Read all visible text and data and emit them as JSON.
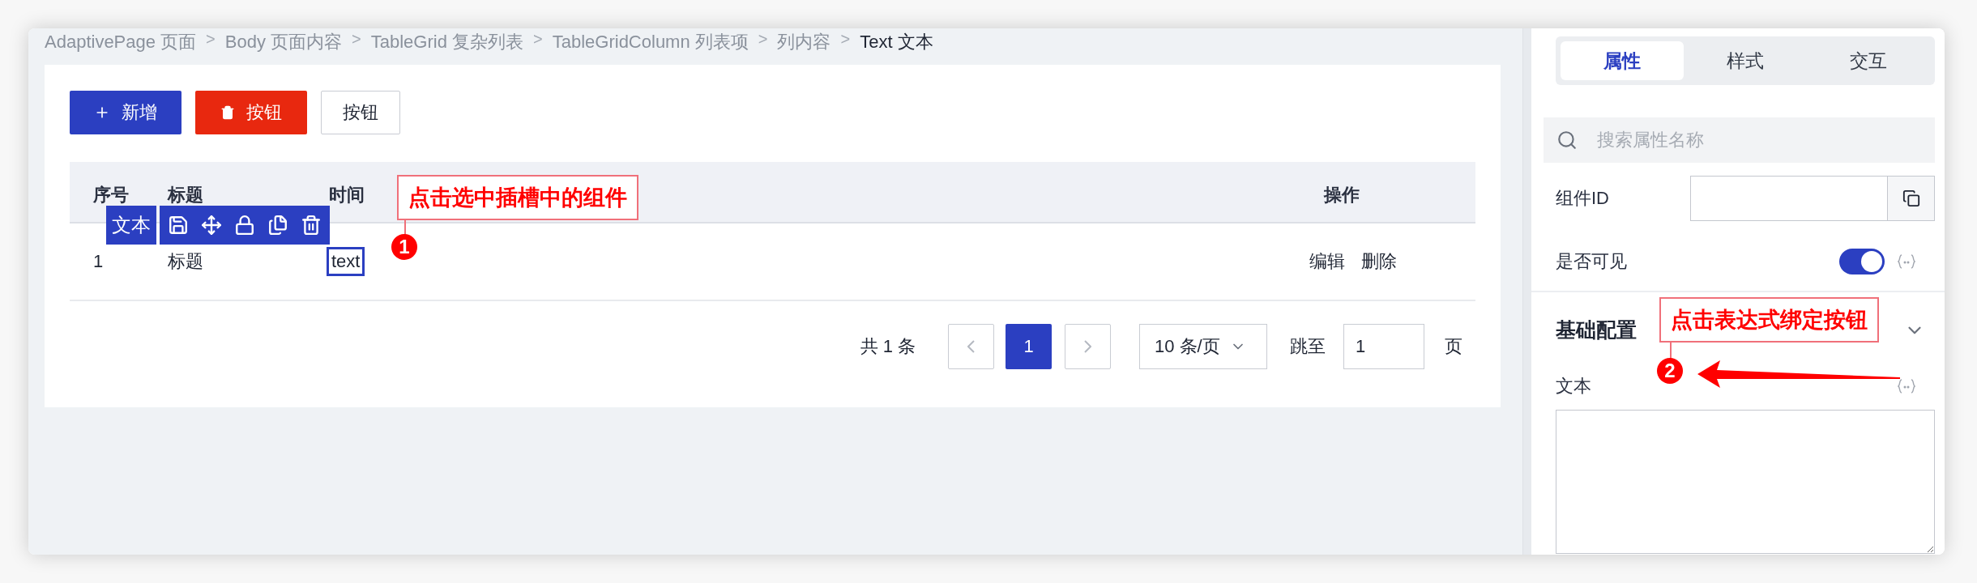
{
  "breadcrumb": [
    {
      "label": "AdaptivePage 页面",
      "current": false
    },
    {
      "label": "Body 页面内容",
      "current": false
    },
    {
      "label": "TableGrid 复杂列表",
      "current": false
    },
    {
      "label": "TableGridColumn 列表项",
      "current": false
    },
    {
      "label": "列内容",
      "current": false
    },
    {
      "label": "Text 文本",
      "current": true
    }
  ],
  "separator": ">",
  "buttons": [
    {
      "kind": "primary",
      "label": "新增"
    },
    {
      "kind": "danger",
      "label": "按钮"
    },
    {
      "kind": "default",
      "label": "按钮"
    }
  ],
  "table": {
    "columns": [
      "序号",
      "标题",
      "时间",
      "操作"
    ],
    "rows": [
      {
        "cells": [
          {
            "text": "1",
            "selected": false
          },
          {
            "text": "标题",
            "selected": false
          },
          {
            "text": "text",
            "selected": true
          }
        ],
        "actions": [
          "编辑",
          "删除"
        ]
      }
    ]
  },
  "selection_toolbar": {
    "label": "文本"
  },
  "pagination": {
    "total": "共 1 条",
    "pages": [
      {
        "label": "1",
        "selected": true
      }
    ],
    "page_size": "10 条/页",
    "jump_label": "跳至",
    "jump_value": "1",
    "page_suffix": "页"
  },
  "properties_panel": {
    "tabs": [
      {
        "label": "属性",
        "selected": true
      },
      {
        "label": "样式",
        "selected": false
      },
      {
        "label": "交互",
        "selected": false
      }
    ],
    "search": {
      "placeholder": "搜索属性名称"
    },
    "component_id": {
      "label": "组件ID"
    },
    "visible": {
      "label": "是否可见",
      "on": true
    },
    "section": {
      "title": "基础配置",
      "expanded": true
    },
    "text_field": {
      "label": "文本"
    }
  },
  "annotations": [
    {
      "number": "1",
      "text": "点击选中插槽中的组件"
    },
    {
      "number": "2",
      "text": "点击表达式绑定按钮"
    }
  ]
}
